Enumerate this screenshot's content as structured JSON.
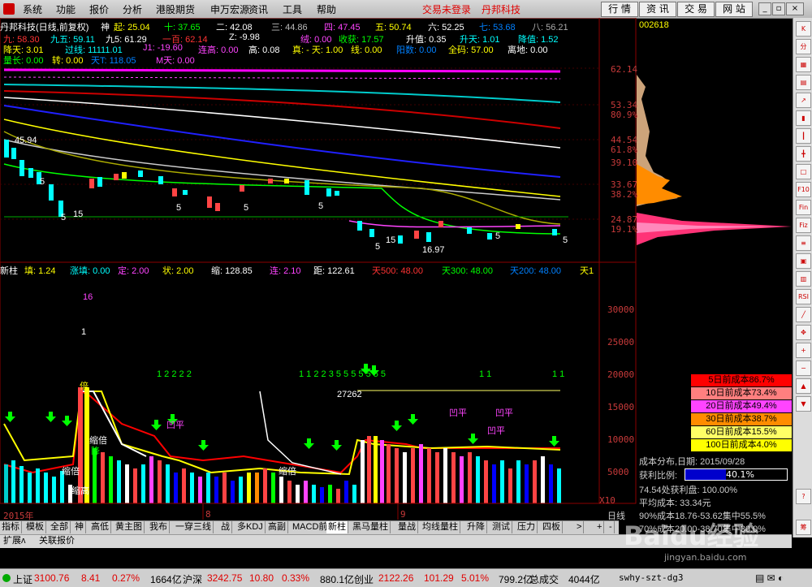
{
  "menubar": {
    "items": [
      "系统",
      "功能",
      "报价",
      "分析",
      "港股期货",
      "申万宏源",
      "资讯",
      "工具",
      "帮助"
    ],
    "status_login": "交易未登录",
    "brand": "丹邦科技",
    "nav": [
      "行 情",
      "资 讯",
      "交 易",
      "网 站"
    ]
  },
  "chart": {
    "title": "丹邦科技(日线,前复权)",
    "stock_code": "002618",
    "indicators_row1": [
      {
        "text": "神",
        "color": "#ffffff"
      },
      {
        "text": "起: 25.04",
        "color": "#ffff00"
      },
      {
        "text": "十: 37.65",
        "color": "#00ff00"
      },
      {
        "text": "二: 42.08",
        "color": "#ffffff"
      },
      {
        "text": "三: 44.86",
        "color": "#bbbbbb"
      },
      {
        "text": "四: 47.45",
        "color": "#ff44ff"
      },
      {
        "text": "五: 50.74",
        "color": "#ffff00"
      },
      {
        "text": "六: 52.25",
        "color": "#ffffff"
      },
      {
        "text": "七: 53.68",
        "color": "#0080ff"
      },
      {
        "text": "八: 56.21",
        "color": "#aaaaaa"
      }
    ],
    "indicators_row2": [
      {
        "text": "九: 58.30",
        "color": "#ff3333"
      },
      {
        "text": "九五: 59.11",
        "color": "#00ffff"
      },
      {
        "text": "九5: 61.29",
        "color": "#ffffff"
      },
      {
        "text": "一百: 62.14",
        "color": "#ff3333"
      },
      {
        "text": "Z: -9.98",
        "color": "#ffffff"
      },
      {
        "text": "绒: 0.00",
        "color": "#ff44ff"
      },
      {
        "text": "收获: 17.57",
        "color": "#00ff00"
      },
      {
        "text": "升值: 0.35",
        "color": "#ffffff"
      },
      {
        "text": "升天: 1.01",
        "color": "#00ffff"
      },
      {
        "text": "降值: 1.52",
        "color": "#00ffff"
      }
    ],
    "indicators_row3": [
      {
        "text": "降天: 3.01",
        "color": "#ffff00"
      },
      {
        "text": "过线: 11111.01",
        "color": "#00ffff"
      },
      {
        "text": "J1: -19.60",
        "color": "#ff44ff"
      },
      {
        "text": "连高: 0.00",
        "color": "#ff44ff"
      },
      {
        "text": "高: 0.08",
        "color": "#ffffff"
      },
      {
        "text": "真: - 天: 1.00",
        "color": "#ffff00"
      },
      {
        "text": "线: 0.00",
        "color": "#ffff00"
      },
      {
        "text": "阳数: 0.00",
        "color": "#0080ff"
      },
      {
        "text": "全码: 57.00",
        "color": "#ffff00"
      },
      {
        "text": "离地: 0.00",
        "color": "#ffffff"
      }
    ],
    "indicators_row4": [
      {
        "text": "量长: 0.00",
        "color": "#00ff00"
      },
      {
        "text": "转: 0.00",
        "color": "#ffff00"
      },
      {
        "text": "天T: 118.05",
        "color": "#0080ff"
      },
      {
        "text": "M天: 0.00",
        "color": "#ff44ff"
      }
    ],
    "price_labels": [
      "62.14",
      "53.34",
      "80.9%",
      "44.54",
      "61.8%",
      "39.10",
      "33.67",
      "38.2%",
      "24.87",
      "19.1%"
    ],
    "price_marks": [
      "45.94",
      "5",
      "15",
      "5",
      "5",
      "5",
      "5",
      "15",
      "5",
      "5",
      "5",
      "16.97"
    ],
    "lower_header": [
      {
        "text": "新柱",
        "color": "#ffffff"
      },
      {
        "text": "填: 1.24",
        "color": "#ffff00"
      },
      {
        "text": "涨填: 0.00",
        "color": "#00ffff"
      },
      {
        "text": "定: 2.00",
        "color": "#ff44ff"
      },
      {
        "text": "状: 2.00",
        "color": "#ffff00"
      },
      {
        "text": "缩: 128.85",
        "color": "#ffffff"
      },
      {
        "text": "连: 2.10",
        "color": "#ff44ff"
      },
      {
        "text": "距: 122.61",
        "color": "#ffffff"
      },
      {
        "text": "天500: 48.00",
        "color": "#ff3333"
      },
      {
        "text": "天300: 48.00",
        "color": "#00ff00"
      },
      {
        "text": "天200: 48.00",
        "color": "#0080ff"
      },
      {
        "text": "天1",
        "color": "#ffff00"
      }
    ],
    "lower_axis": [
      "30000",
      "25000",
      "20000",
      "15000",
      "10000",
      "5000"
    ],
    "lower_marks": [
      "16",
      "1",
      "1 2 2  2 2",
      "1 1 2  2 3 5 5 5 5 5 5 5",
      "1  1",
      "1  1",
      "倍",
      "缩倍",
      "降",
      "缩高",
      "缩倍",
      "缩倍",
      "凹平",
      "凹平",
      "凹平",
      "凹平",
      "27262"
    ],
    "lower_unit": "X10",
    "date_labels": [
      "2015年",
      "8",
      "9"
    ],
    "period_label": "日线"
  },
  "cost": {
    "rows": [
      {
        "text": "5日前成本86.7%",
        "bg": "#ff0000"
      },
      {
        "text": "10日前成本73.4%",
        "bg": "#ff7f7f"
      },
      {
        "text": "20日前成本49.4%",
        "bg": "#ff44ff"
      },
      {
        "text": "30日前成本38.7%",
        "bg": "#ff8c00"
      },
      {
        "text": "60日前成本15.5%",
        "bg": "#ffff66"
      },
      {
        "text": "100日前成本4.0%",
        "bg": "#ffff00"
      }
    ],
    "dist_date": "成本分布,日期: 2015/09/28",
    "profit_label": "获利比例:",
    "profit_value": "40.1%",
    "profit_ratio": 0.401,
    "price_profit": "74.54处获利盘: 100.00%",
    "avg_cost": "平均成本: 33.34元",
    "cost90": "90%成本18.76-53.62集中55.5%",
    "cost70": "70%成本20.00-38.70集中30.0%"
  },
  "tabs": {
    "items": [
      "指标",
      "模板",
      "全部",
      "神",
      "高低",
      "黄主图",
      "我布",
      "一穿三线",
      "战",
      "多KDJ",
      "高副",
      "MACD前",
      "新柱",
      "黑马量柱",
      "量战",
      "均线量柱",
      "升降",
      "测试",
      "压力",
      "四板"
    ],
    "active": "新柱",
    "extra": [
      ">",
      "+",
      "-"
    ],
    "sub": [
      "扩展ʌ",
      "关联报价"
    ]
  },
  "statusbar": {
    "sh_label": "上证",
    "sh_val": "3100.76",
    "sh_chg": "8.41",
    "sh_pct": "0.27%",
    "sh_amt": "1664亿",
    "sz_label": "沪深",
    "sz_val": "3242.75",
    "sz_chg": "10.80",
    "sz_pct": "0.33%",
    "sz_amt": "880.1亿",
    "cy_label": "创业",
    "cy_val": "2122.26",
    "cy_chg": "101.29",
    "cy_pct": "5.01%",
    "cy_amt": "799.2亿",
    "total_label": "总成交",
    "total_val": "4044亿",
    "server": "swhy-szt-dg3"
  },
  "watermark": {
    "text": "Baidu经验",
    "sub": "jingyan.baidu.com"
  }
}
